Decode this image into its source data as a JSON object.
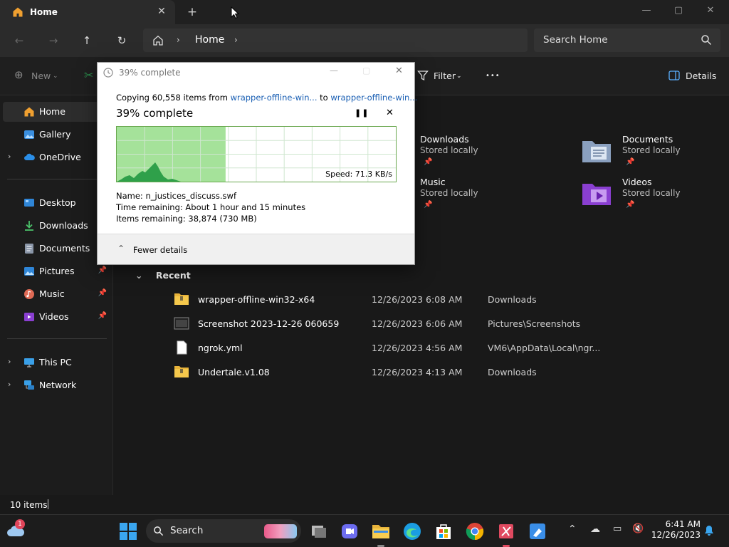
{
  "tab": {
    "title": "Home",
    "close": "✕",
    "new": "+"
  },
  "window": {
    "minimize": "—",
    "maximize": "▢",
    "close": "✕"
  },
  "address": {
    "home_label": "Home",
    "search_placeholder": "Search Home"
  },
  "toolbar": {
    "new_label": "New",
    "filter_label": "Filter",
    "more": "•••",
    "details_label": "Details"
  },
  "sidebar": {
    "items": [
      {
        "label": "Home"
      },
      {
        "label": "Gallery"
      },
      {
        "label": "OneDrive"
      },
      {
        "label": "Desktop"
      },
      {
        "label": "Downloads"
      },
      {
        "label": "Documents"
      },
      {
        "label": "Pictures"
      },
      {
        "label": "Music"
      },
      {
        "label": "Videos"
      },
      {
        "label": "This PC"
      },
      {
        "label": "Network"
      }
    ]
  },
  "quick_access": [
    {
      "name": "Downloads",
      "sub": "Stored locally"
    },
    {
      "name": "Documents",
      "sub": "Stored locally"
    },
    {
      "name": "Music",
      "sub": "Stored locally"
    },
    {
      "name": "Videos",
      "sub": "Stored locally"
    }
  ],
  "recent": {
    "title": "Recent",
    "rows": [
      {
        "name": "wrapper-offline-win32-x64",
        "date": "12/26/2023 6:08 AM",
        "location": "Downloads"
      },
      {
        "name": "Screenshot 2023-12-26 060659",
        "date": "12/26/2023 6:06 AM",
        "location": "Pictures\\Screenshots"
      },
      {
        "name": "ngrok.yml",
        "date": "12/26/2023 4:56 AM",
        "location": "VM6\\AppData\\Local\\ngr..."
      },
      {
        "name": "Undertale.v1.08",
        "date": "12/26/2023 4:13 AM",
        "location": "Downloads"
      }
    ]
  },
  "status": {
    "items": "10 items"
  },
  "dialog": {
    "title": "39% complete",
    "copy_prefix": "Copying 60,558 items from ",
    "source": "wrapper-offline-win...",
    "copy_mid": " to ",
    "dest": "wrapper-offline-win...",
    "heading": "39% complete",
    "progress": 0.39,
    "speed": "Speed: 71.3 KB/s",
    "name": "Name:  n_justices_discuss.swf",
    "time_remaining": "Time remaining:  About 1 hour and 15 minutes",
    "items_remaining": "Items remaining:  38,874 (730 MB)",
    "fewer_details": "Fewer details",
    "accent": "#06b025"
  },
  "taskbar": {
    "search": "Search",
    "time": "6:41 AM",
    "date": "12/26/2023",
    "badge": "1"
  }
}
